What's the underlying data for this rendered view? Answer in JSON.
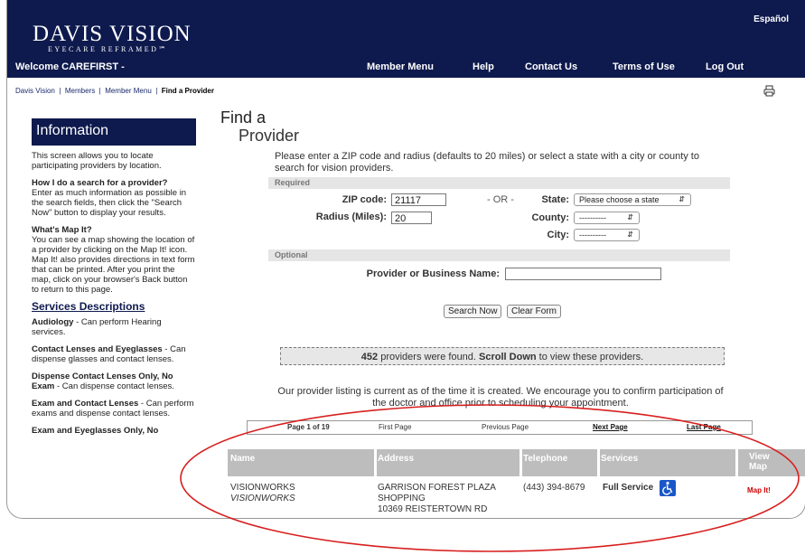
{
  "header": {
    "logo_main": "DAVIS VISION",
    "logo_sub": "EYECARE REFRAMED℠",
    "language_link": "Español",
    "welcome": "Welcome CAREFIRST -",
    "nav": [
      "Member Menu",
      "Help",
      "Contact Us",
      "Terms of Use",
      "Log Out"
    ]
  },
  "breadcrumb": {
    "items": [
      "Davis Vision",
      "Members",
      "Member Menu"
    ],
    "current": "Find a Provider",
    "separator": "|"
  },
  "sidebar": {
    "title": "Information",
    "intro": "This screen allows you to locate participating providers by location.",
    "q1_title": "How I do a search for a provider?",
    "q1_body": "Enter as much information as possible in the search fields, then click the \"Search Now\" button to display your results.",
    "q2_title": "What's Map It?",
    "q2_body": "You can see a map showing the location of a provider by clicking on the Map It! icon. Map It! also provides directions in text form that can be printed. After you print the map, click on your browser's Back button to return to this page.",
    "services_title": "Services Descriptions",
    "services": [
      {
        "name": "Audiology",
        "desc": " - Can perform Hearing services."
      },
      {
        "name": "Contact Lenses and Eyeglasses",
        "desc": " - Can dispense glasses and contact lenses."
      },
      {
        "name": "Dispense Contact Lenses Only, No Exam",
        "desc": " - Can dispense contact lenses."
      },
      {
        "name": "Exam and Contact Lenses",
        "desc": " - Can perform exams and dispense contact lenses."
      },
      {
        "name": "Exam and Eyeglasses Only, No",
        "desc": ""
      }
    ]
  },
  "page": {
    "title_line1": "Find a",
    "title_line2": "Provider",
    "intro": "Please enter a ZIP code and radius (defaults to 20 miles) or select a state with a city or county to search for vision providers."
  },
  "form": {
    "required_label": "Required",
    "optional_label": "Optional",
    "zip_label": "ZIP code:",
    "zip_value": "21117",
    "radius_label": "Radius (Miles):",
    "radius_value": "20",
    "or_text": "- OR -",
    "state_label": "State:",
    "state_value": "Please choose a state",
    "county_label": "County:",
    "county_value": "----------",
    "city_label": "City:",
    "city_value": "----------",
    "provider_label": "Provider or Business Name:",
    "provider_value": "",
    "search_button": "Search Now",
    "clear_button": "Clear Form"
  },
  "results": {
    "count": "452",
    "found_mid": " providers were found. ",
    "scroll": "Scroll Down",
    "found_end": " to view these providers.",
    "notice": "Our provider listing is current as of the time it is created. We encourage you to confirm participation of the doctor and office prior to scheduling your appointment."
  },
  "pager": {
    "page_info": "Page 1 of 19",
    "first": "First Page",
    "previous": "Previous Page",
    "next": "Next Page",
    "last": "Last Page"
  },
  "table": {
    "headers": [
      "Name",
      "Address",
      "Telephone",
      "Services",
      "View",
      "Map"
    ],
    "rows": [
      {
        "name": "VISIONWORKS",
        "business": "VISIONWORKS",
        "address1": "GARRISON FOREST PLAZA",
        "address2": "SHOPPING",
        "address3": "10369 REISTERTOWN RD",
        "phone": "(443) 394-8679",
        "service": "Full Service",
        "map": "Map It!"
      }
    ]
  },
  "colors": {
    "brand_navy": "#0e1a4d",
    "section_gray": "#e5e5e5",
    "table_header_gray": "#bdbdbd",
    "map_link_red": "#cc0000",
    "annotation_oval_red": "#d81f1f",
    "accessibility_blue": "#1a56c8"
  }
}
